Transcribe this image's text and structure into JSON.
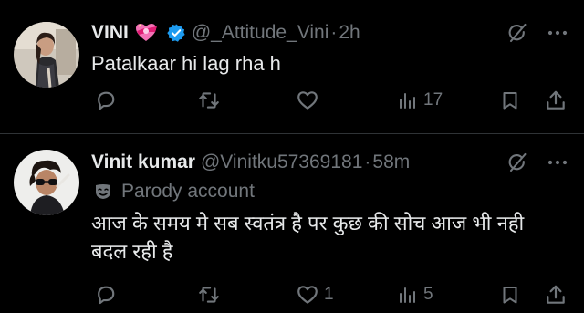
{
  "colors": {
    "background": "#000000",
    "text_primary": "#e7e9ea",
    "text_secondary": "#71767b",
    "divider": "#2f3336",
    "verified_blue": "#1d9bf0",
    "heart_pink": "#f91880"
  },
  "tweets": [
    {
      "author_name": "VINI",
      "name_emoji": "heart-with-ribbon",
      "verified": true,
      "handle": "@_Attitude_Vini",
      "separator": "·",
      "time": "2h",
      "text": "Patalkaar hi lag rha h",
      "actions": {
        "reply_count": "",
        "repost_count": "",
        "like_count": "",
        "views_count": "17"
      }
    },
    {
      "author_name": "Vinit kumar",
      "handle": "@Vinitku57369181",
      "separator": "·",
      "time": "58m",
      "parody_label": "Parody account",
      "text_line_1": "आज के समय मे सब स्वतंत्र है पर कुछ  की सोच आज भी नही",
      "text_line_2": "बदल रही है",
      "actions": {
        "reply_count": "",
        "repost_count": "",
        "like_count": "1",
        "views_count": "5"
      }
    }
  ],
  "icons": [
    "grok-icon",
    "more-icon",
    "reply-icon",
    "repost-icon",
    "like-icon",
    "views-icon",
    "bookmark-icon",
    "share-icon",
    "verified-badge-icon",
    "heart-ribbon-emoji-icon",
    "parody-mask-icon"
  ]
}
